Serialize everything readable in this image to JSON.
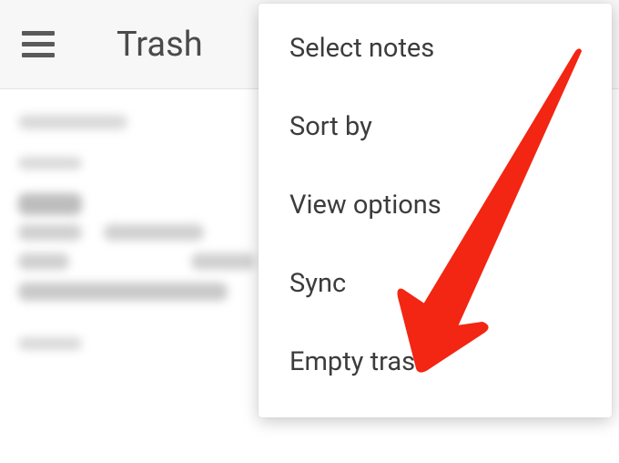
{
  "header": {
    "title": "Trash"
  },
  "menu": {
    "items": [
      {
        "label": "Select notes"
      },
      {
        "label": "Sort by"
      },
      {
        "label": "View options"
      },
      {
        "label": "Sync"
      },
      {
        "label": "Empty trash"
      }
    ]
  },
  "annotation": {
    "arrow_color": "#f22613"
  }
}
